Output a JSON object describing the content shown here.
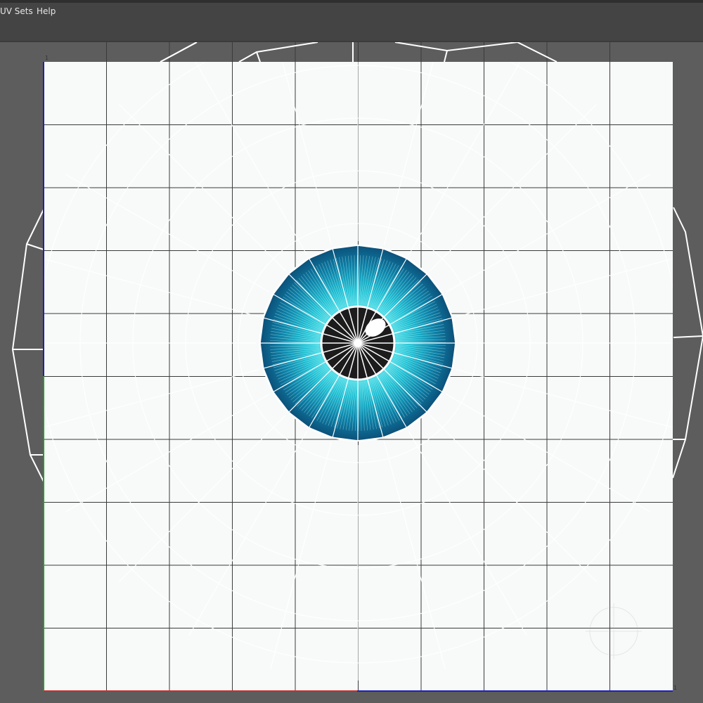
{
  "menu": {
    "items": [
      "UV Sets",
      "Help"
    ]
  },
  "uv_editor": {
    "grid_divisions": 10,
    "corner_label_top_left": "1",
    "corner_label_bottom_right": "1",
    "colors": {
      "viewport_bg": "#5d5d5d",
      "uv_tile": "#f8fafa",
      "grid_line": "#3a3a3a",
      "mesh_line": "#ffffff",
      "u_axis": "#c03030",
      "v_axis": "#20a020",
      "axis_blue": "#2020b0",
      "iris_light": "#5ee8ee",
      "iris_dark": "#0c4f78",
      "pupil": "#1c1c1c"
    },
    "icons": [
      "manipulator-crosshair-icon"
    ]
  }
}
